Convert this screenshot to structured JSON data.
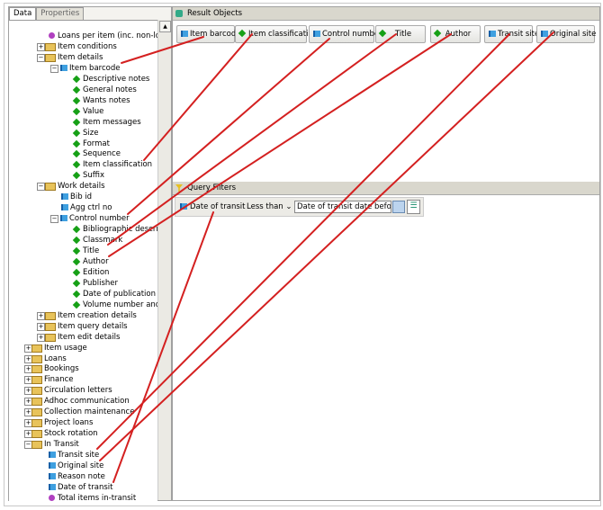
{
  "left_panel": {
    "tabs": [
      "Data",
      "Properties"
    ],
    "tree": [
      {
        "label": "Loans per item (inc. non-loans)",
        "type": "purple",
        "lvl": 2
      },
      {
        "label": "Item conditions",
        "type": "folder",
        "lvl": 2,
        "exp": "+"
      },
      {
        "label": "Item details",
        "type": "folder",
        "lvl": 2,
        "exp": "-"
      },
      {
        "label": "Item barcode",
        "type": "blue",
        "lvl": 3,
        "exp": "-"
      },
      {
        "label": "Descriptive notes",
        "type": "green",
        "lvl": 4
      },
      {
        "label": "General notes",
        "type": "green",
        "lvl": 4
      },
      {
        "label": "Wants notes",
        "type": "green",
        "lvl": 4
      },
      {
        "label": "Value",
        "type": "green",
        "lvl": 4
      },
      {
        "label": "Item messages",
        "type": "green",
        "lvl": 4
      },
      {
        "label": "Size",
        "type": "green",
        "lvl": 4
      },
      {
        "label": "Format",
        "type": "green",
        "lvl": 4
      },
      {
        "label": "Sequence",
        "type": "green",
        "lvl": 4
      },
      {
        "label": "Item classification",
        "type": "green",
        "lvl": 4
      },
      {
        "label": "Suffix",
        "type": "green",
        "lvl": 4
      },
      {
        "label": "Work details",
        "type": "folder",
        "lvl": 2,
        "exp": "-"
      },
      {
        "label": "Bib id",
        "type": "blue",
        "lvl": 3
      },
      {
        "label": "Agg ctrl no",
        "type": "blue",
        "lvl": 3
      },
      {
        "label": "Control number",
        "type": "blue",
        "lvl": 3,
        "exp": "-"
      },
      {
        "label": "Bibliographic descriptio",
        "type": "green",
        "lvl": 4
      },
      {
        "label": "Classmark",
        "type": "green",
        "lvl": 4
      },
      {
        "label": "Title",
        "type": "green",
        "lvl": 4
      },
      {
        "label": "Author",
        "type": "green",
        "lvl": 4
      },
      {
        "label": "Edition",
        "type": "green",
        "lvl": 4
      },
      {
        "label": "Publisher",
        "type": "green",
        "lvl": 4
      },
      {
        "label": "Date of publication",
        "type": "green",
        "lvl": 4
      },
      {
        "label": "Volume number and titl",
        "type": "green",
        "lvl": 4
      },
      {
        "label": "Item creation details",
        "type": "folder",
        "lvl": 2,
        "exp": "+"
      },
      {
        "label": "Item query details",
        "type": "folder",
        "lvl": 2,
        "exp": "+"
      },
      {
        "label": "Item edit details",
        "type": "folder",
        "lvl": 2,
        "exp": "+"
      },
      {
        "label": "Item usage",
        "type": "folder",
        "lvl": 1,
        "exp": "+"
      },
      {
        "label": "Loans",
        "type": "folder",
        "lvl": 1,
        "exp": "+"
      },
      {
        "label": "Bookings",
        "type": "folder",
        "lvl": 1,
        "exp": "+"
      },
      {
        "label": "Finance",
        "type": "folder",
        "lvl": 1,
        "exp": "+"
      },
      {
        "label": "Circulation letters",
        "type": "folder",
        "lvl": 1,
        "exp": "+"
      },
      {
        "label": "Adhoc communication",
        "type": "folder",
        "lvl": 1,
        "exp": "+"
      },
      {
        "label": "Collection maintenance",
        "type": "folder",
        "lvl": 1,
        "exp": "+"
      },
      {
        "label": "Project loans",
        "type": "folder",
        "lvl": 1,
        "exp": "+"
      },
      {
        "label": "Stock rotation",
        "type": "folder",
        "lvl": 1,
        "exp": "+"
      },
      {
        "label": "In Transit",
        "type": "folder",
        "lvl": 1,
        "exp": "-"
      },
      {
        "label": "Transit site",
        "type": "blue",
        "lvl": 2
      },
      {
        "label": "Original site",
        "type": "blue",
        "lvl": 2
      },
      {
        "label": "Reason note",
        "type": "blue",
        "lvl": 2
      },
      {
        "label": "Date of transit",
        "type": "blue",
        "lvl": 2
      },
      {
        "label": "Total items in-transit",
        "type": "purple",
        "lvl": 2
      }
    ]
  },
  "result_objects": {
    "title": "Result Objects",
    "items": [
      {
        "label": "Item barcode",
        "type": "blue"
      },
      {
        "label": "Item classification",
        "type": "green"
      },
      {
        "label": "Control number",
        "type": "blue"
      },
      {
        "label": "Title",
        "type": "green"
      },
      {
        "label": "Author",
        "type": "green"
      },
      {
        "label": "Transit site",
        "type": "blue"
      },
      {
        "label": "Original site",
        "type": "blue"
      }
    ]
  },
  "query_filters": {
    "title": "Query Filters",
    "filter": {
      "object": "Date of transit",
      "operator": "Less than",
      "value": "Date of transit date before:"
    }
  },
  "annotation_color": "#d42020"
}
